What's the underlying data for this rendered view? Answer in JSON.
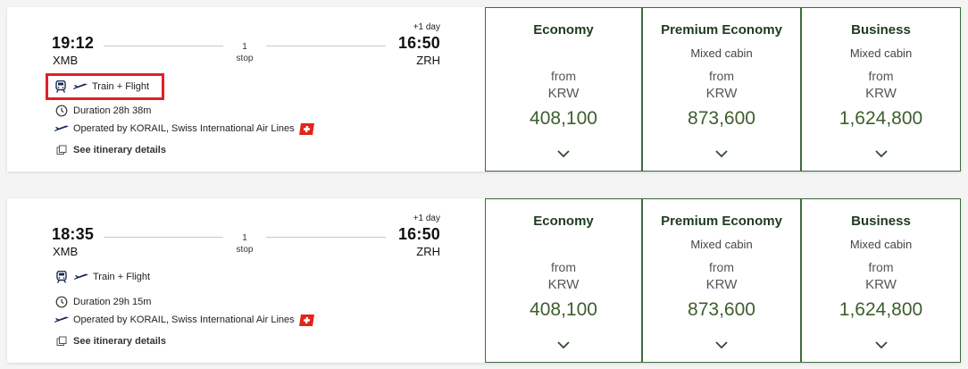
{
  "results": [
    {
      "departure": {
        "time": "19:12",
        "code": "XMB"
      },
      "arrival": {
        "time": "16:50",
        "code": "ZRH",
        "day_offset": "+1 day"
      },
      "stops_count": "1",
      "stops_label": "stop",
      "transport_label": "Train + Flight",
      "duration_label": "Duration 28h 38m",
      "operated_label": "Operated by KORAIL, Swiss International Air Lines",
      "itinerary_link": "See itinerary details",
      "highlighted": true,
      "fares": [
        {
          "cabin": "Economy",
          "note": "",
          "from": "from",
          "currency": "KRW",
          "price": "408,100"
        },
        {
          "cabin": "Premium Economy",
          "note": "Mixed cabin",
          "from": "from",
          "currency": "KRW",
          "price": "873,600"
        },
        {
          "cabin": "Business",
          "note": "Mixed cabin",
          "from": "from",
          "currency": "KRW",
          "price": "1,624,800"
        }
      ]
    },
    {
      "departure": {
        "time": "18:35",
        "code": "XMB"
      },
      "arrival": {
        "time": "16:50",
        "code": "ZRH",
        "day_offset": "+1 day"
      },
      "stops_count": "1",
      "stops_label": "stop",
      "transport_label": "Train + Flight",
      "duration_label": "Duration 29h 15m",
      "operated_label": "Operated by KORAIL, Swiss International Air Lines",
      "itinerary_link": "See itinerary details",
      "highlighted": false,
      "fares": [
        {
          "cabin": "Economy",
          "note": "",
          "from": "from",
          "currency": "KRW",
          "price": "408,100"
        },
        {
          "cabin": "Premium Economy",
          "note": "Mixed cabin",
          "from": "from",
          "currency": "KRW",
          "price": "873,600"
        },
        {
          "cabin": "Business",
          "note": "Mixed cabin",
          "from": "from",
          "currency": "KRW",
          "price": "1,624,800"
        }
      ]
    }
  ],
  "icons": {
    "train": "train-icon",
    "plane": "plane-icon",
    "clock": "clock-icon",
    "external": "external-link-icon",
    "chevron": "chevron-down-icon",
    "airline_logo": "swiss-flag-icon"
  },
  "colors": {
    "fare_border": "#3e6b3e",
    "price_text": "#3e5e2e",
    "highlight_box": "#e0202a",
    "swiss_red": "#e1251b"
  }
}
